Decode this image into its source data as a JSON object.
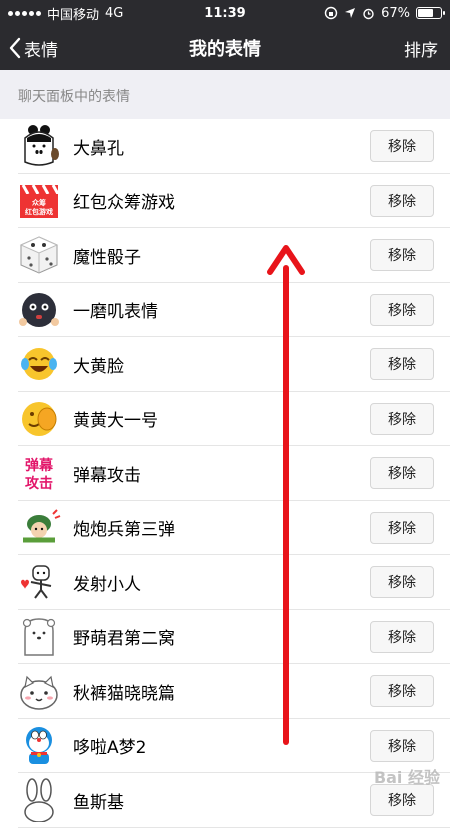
{
  "status_bar": {
    "carrier": "中国移动",
    "network": "4G",
    "time": "11:39",
    "battery": "67%",
    "battery_level": 0.67
  },
  "nav": {
    "back_label": "表情",
    "title": "我的表情",
    "sort_label": "排序"
  },
  "section_title": "聊天面板中的表情",
  "remove_label": "移除",
  "items": [
    {
      "name": "大鼻孔"
    },
    {
      "name": "红包众筹游戏",
      "icon_text": "众筹 红包游戏"
    },
    {
      "name": "魔性骰子"
    },
    {
      "name": "一磨叽表情"
    },
    {
      "name": "大黄脸"
    },
    {
      "name": "黄黄大一号"
    },
    {
      "name": "弹幕攻击",
      "icon_text": "弹幕攻击"
    },
    {
      "name": "炮炮兵第三弹"
    },
    {
      "name": "发射小人"
    },
    {
      "name": "野萌君第二窝"
    },
    {
      "name": "秋裤猫晓晓篇"
    },
    {
      "name": "哆啦A梦2"
    },
    {
      "name": "鱼斯基"
    }
  ],
  "arrow_color": "#e8141a",
  "watermark": "Bai 经验"
}
